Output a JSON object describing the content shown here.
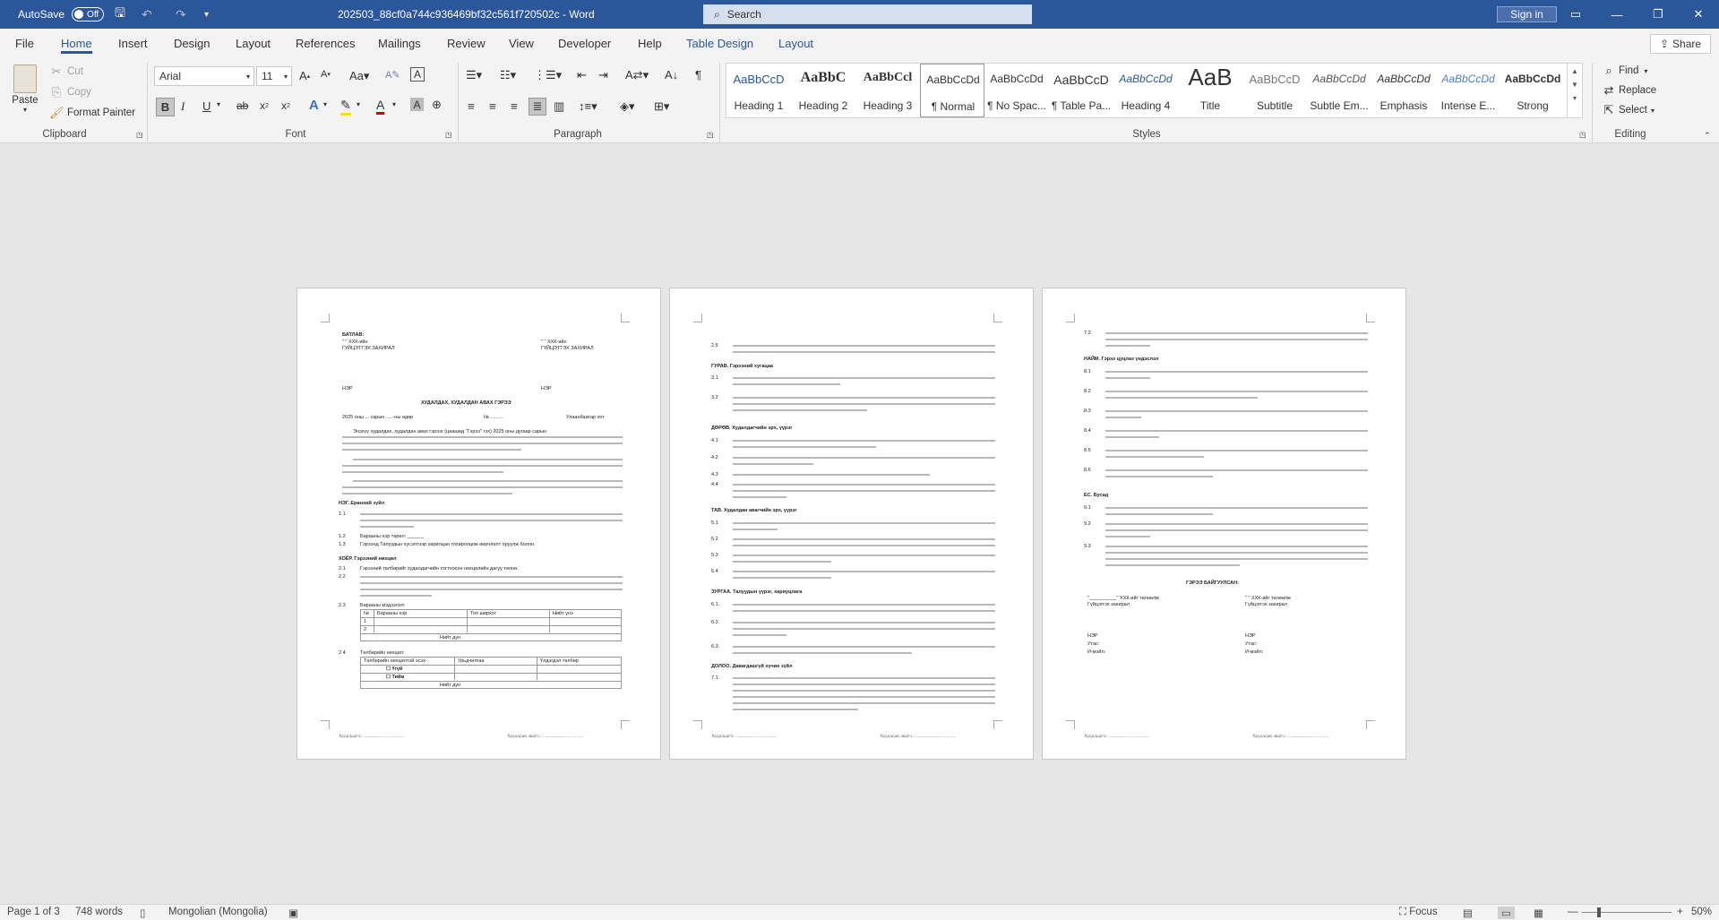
{
  "titlebar": {
    "autosave_label": "AutoSave",
    "autosave_state": "Off",
    "doc_title": "202503_88cf0a744c936469bf32c561f720502c  -  Word",
    "search_placeholder": "Search",
    "signin_label": "Sign in"
  },
  "menu": {
    "tabs": [
      "File",
      "Home",
      "Insert",
      "Design",
      "Layout",
      "References",
      "Mailings",
      "Review",
      "View",
      "Developer",
      "Help",
      "Table Design",
      "Layout"
    ],
    "share_label": "Share"
  },
  "ribbon": {
    "paste": "Paste",
    "cut": "Cut",
    "copy": "Copy",
    "format_painter": "Format Painter",
    "font_name": "Arial",
    "font_size": "11",
    "styles": [
      {
        "preview": "AaBbCcD",
        "name": "Heading 1"
      },
      {
        "preview": "AaBbC",
        "name": "Heading 2"
      },
      {
        "preview": "AaBbCcl",
        "name": "Heading 3"
      },
      {
        "preview": "AaBbCcDd",
        "name": "¶ Normal"
      },
      {
        "preview": "AaBbCcDd",
        "name": "¶ No Spac..."
      },
      {
        "preview": "AaBbCcD",
        "name": "¶ Table Pa..."
      },
      {
        "preview": "AaBbCcDd",
        "name": "Heading 4"
      },
      {
        "preview": "AaB",
        "name": "Title"
      },
      {
        "preview": "AaBbCcD",
        "name": "Subtitle"
      },
      {
        "preview": "AaBbCcDd",
        "name": "Subtle Em..."
      },
      {
        "preview": "AaBbCcDd",
        "name": "Emphasis"
      },
      {
        "preview": "AaBbCcDd",
        "name": "Intense E..."
      },
      {
        "preview": "AaBbCcDd",
        "name": "Strong"
      }
    ],
    "find": "Find",
    "replace": "Replace",
    "select": "Select",
    "groups": {
      "clipboard": "Clipboard",
      "font": "Font",
      "paragraph": "Paragraph",
      "styles": "Styles",
      "editing": "Editing"
    }
  },
  "pages": {
    "p1": {
      "batlav": "БАТЛАВ:",
      "director_left": "ГҮЙЦЭТГЭХ ЗАХИРАЛ",
      "director_right": "ГҮЙЦЭТГЭХ ЗАХИРАЛ",
      "co_left": "\"          \" ХХК-ийн",
      "co_right": "\"          \" ХХК-ийн",
      "ner_left": "НЭР",
      "ner_right": "НЭР",
      "contract_title": "ХУДАЛДАХ, ХУДАЛДАН АВАХ ГЭРЭЭ",
      "date_line": "2025  оны ... сарын .....-ны өдөр",
      "number_line": "№ .........",
      "city": "Улаанбаатар хот",
      "intro": "Энэхүү худалдах, худалдан авах гэрээг (цаашид \"Гэрээ\" гэх) 2025 оны    дугаар сарын",
      "sec1": "НЭГ. Ерөнхий зүйл",
      "sec1_items": [
        "1.1",
        "1.2",
        "1.3"
      ],
      "sec2": "ХОЁР. Гэрээний нөхцөл",
      "item_1_2": "Барааны нэр төрөл: ______",
      "item_1_3": "Гэрээнд Талуудын хүсэлтээр харилцан тохиролцож өөрчлөлт оруулж болно.",
      "item_2_1": "Гэрээний төлбөрийг худалдагчийн тогтоосон нөхцөлийн дагуу төлнө.",
      "item_2_3": "Барааны мэдээлэл:",
      "table1_headers": [
        "№",
        "Барааны нэр",
        "Тоо ширхэг",
        "Нийт үнэ"
      ],
      "table1_total": "Нийт дүн",
      "item_2_4": "Төлбөрийн нөхцөл:",
      "table2_headers": [
        "Төлбөрийн нөхцөлтэй эсэх",
        "Урьдчилгаа",
        "Үлдэгдэл төлбөр"
      ],
      "table2_rows": [
        "Үгүй",
        "Тийм"
      ],
      "table2_total": "Нийт дүн"
    },
    "p2": {
      "item_2_5": "Талууд Гэрээнд заасан 2.3-ны дагуу 2.4 төлбөрийн нөхцлийг дагуу заасан...",
      "sec3": "ГУРАВ. Гэрээний хугацаа",
      "sec4": "ДӨРӨВ. Худалдагчийн эрх, үүрэг",
      "sec5": "ТАВ. Худалдан авагчийн эрх, үүрэг",
      "sec6": "ЗУРГАА. Талуудын үүрэг, хариуцлага",
      "sec7": "ДОЛОО. Давагдашгүй хүчин зүйл"
    },
    "p3": {
      "sec8": "НАЙМ. Гэрээ цуцлах үндэслэл",
      "sec9": "ЕС. Бусад",
      "sign_title": "ГЭРЭЭ БАЙГУУЛСАН:",
      "sign_left": "\"__________\" ХХК-ийг төлөөлж",
      "sign_right": "\"          \" ХХК-ийг төлөөлж",
      "sign_left2": "Гүйцэтгэх захирал",
      "sign_right2": "Гүйцэтгэх захирал",
      "ner": "НЭР",
      "phone": "Утас:",
      "email": "И-мэйл:"
    },
    "footer_left": "Худалдагч: .................................",
    "footer_right": "Худалдан авагч : ................................."
  },
  "status": {
    "page": "Page 1 of 3",
    "words": "748 words",
    "language": "Mongolian (Mongolia)",
    "focus": "Focus",
    "zoom": "50%"
  },
  "colors": {
    "title_bar": "#2b579a",
    "accent": "#2b579a"
  }
}
